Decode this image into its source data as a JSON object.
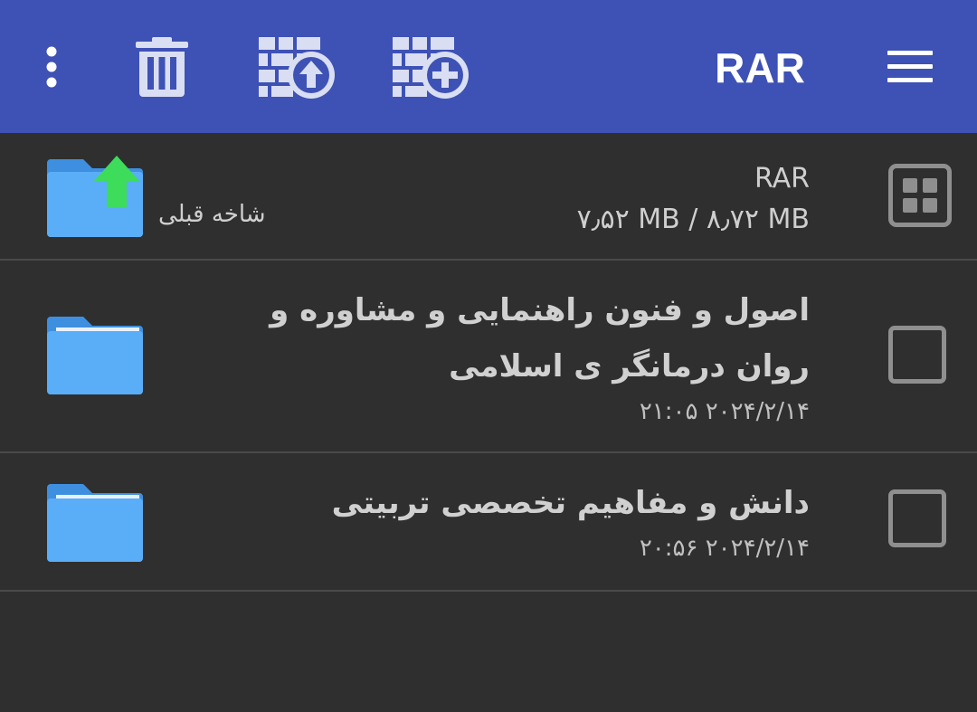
{
  "toolbar": {
    "title": "RAR",
    "background": "#3e51b5",
    "icons": [
      "more-vert-icon",
      "delete-icon",
      "extract-archive-icon",
      "add-to-archive-icon",
      "menu-icon"
    ]
  },
  "parent_row": {
    "label": "شاخه قبلی",
    "archive_name": "RAR",
    "size_info": "۷٫۵۲ MB / ۸٫۷۲ MB",
    "icon": "folder-up-icon"
  },
  "files": [
    {
      "name": "اصول و فنون راهنمایی و مشاوره و روان درمانگر ی اسلامی",
      "date": "۲۱:۰۵ ۲۰۲۴/۲/۱۴",
      "checked": false,
      "icon": "folder-icon"
    },
    {
      "name": "دانش و مفاهیم تخصصی تربیتی",
      "date": "۲۰:۵۶ ۲۰۲۴/۲/۱۴",
      "checked": false,
      "icon": "folder-icon"
    }
  ],
  "colors": {
    "background": "#2f2f2f",
    "folder": "#5aaef7",
    "up_arrow": "#3ddc5a"
  }
}
